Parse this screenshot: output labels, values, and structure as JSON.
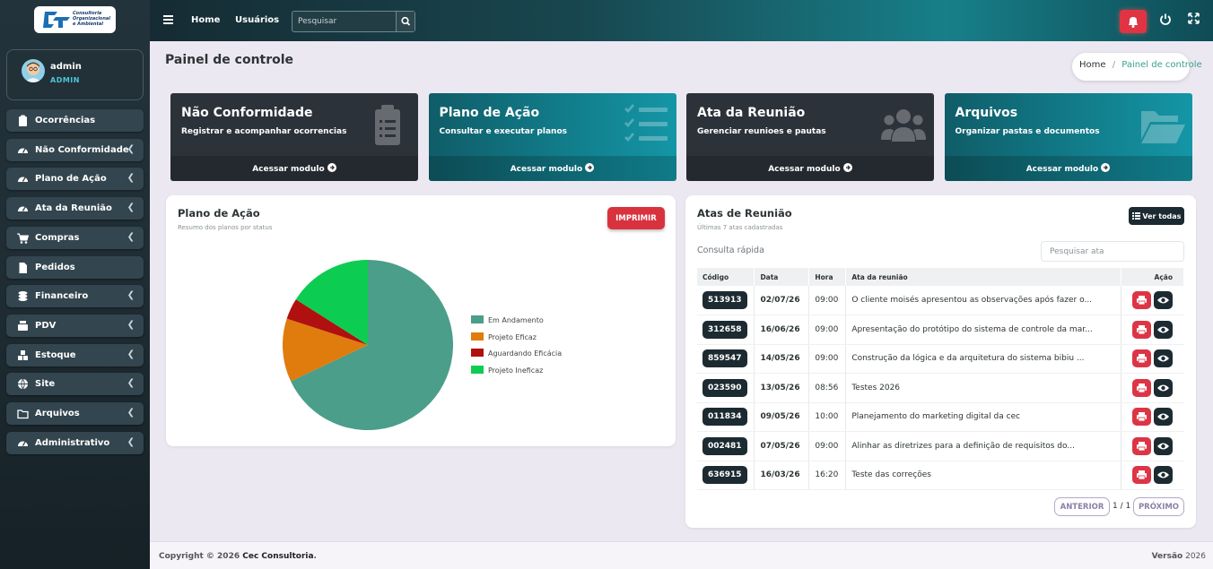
{
  "logo": {
    "text_1": "Consultoria",
    "text_2": "Organizacional",
    "text_3": "e Ambiental"
  },
  "user": {
    "name": "admin",
    "role": "ADMIN"
  },
  "sidebar": {
    "items": [
      {
        "label": "Ocorrências",
        "icon": "clipboard-icon",
        "chevron": false
      },
      {
        "label": "Não Conformidade",
        "icon": "dashboard-icon",
        "chevron": true
      },
      {
        "label": "Plano de Ação",
        "icon": "dashboard-icon",
        "chevron": true
      },
      {
        "label": "Ata da Reunião",
        "icon": "dashboard-icon",
        "chevron": true
      },
      {
        "label": "Compras",
        "icon": "cart-icon",
        "chevron": true
      },
      {
        "label": "Pedidos",
        "icon": "file-icon",
        "chevron": false
      },
      {
        "label": "Financeiro",
        "icon": "coins-icon",
        "chevron": true
      },
      {
        "label": "PDV",
        "icon": "register-icon",
        "chevron": true
      },
      {
        "label": "Estoque",
        "icon": "boxes-icon",
        "chevron": true
      },
      {
        "label": "Site",
        "icon": "globe-icon",
        "chevron": true
      },
      {
        "label": "Arquivos",
        "icon": "folder-icon",
        "chevron": true
      },
      {
        "label": "Administrativo",
        "icon": "dashboard-icon",
        "chevron": true
      }
    ]
  },
  "topbar": {
    "home": "Home",
    "users": "Usuários",
    "search_placeholder": "Pesquisar"
  },
  "page": {
    "title": "Painel de controle",
    "breadcrumb_home": "Home",
    "breadcrumb_sep": "/",
    "breadcrumb_current": "Painel de controle"
  },
  "cards": [
    {
      "title": "Não Conformidade",
      "subtitle": "Registrar e acompanhar ocorrencias",
      "link": "Acessar modulo",
      "icon": "clipboard-list-icon",
      "style": "dark"
    },
    {
      "title": "Plano de Ação",
      "subtitle": "Consultar e executar planos",
      "link": "Acessar modulo",
      "icon": "checklist-icon",
      "style": "teal"
    },
    {
      "title": "Ata da Reunião",
      "subtitle": "Gerenciar reunioes e pautas",
      "link": "Acessar modulo",
      "icon": "users-icon",
      "style": "dark"
    },
    {
      "title": "Arquivos",
      "subtitle": "Organizar pastas e documentos",
      "link": "Acessar modulo",
      "icon": "folder-open-icon",
      "style": "teal"
    }
  ],
  "plano_panel": {
    "title": "Plano de Ação",
    "subtitle": "Resumo dos planos por status",
    "print_label": "IMPRIMIR"
  },
  "chart_data": {
    "type": "pie",
    "title": "",
    "categories": [
      "Em Andamento",
      "Projeto Eficaz",
      "Aguardando Eficácia",
      "Projeto Ineficaz"
    ],
    "values": [
      68,
      12,
      4,
      16
    ],
    "colors": [
      "#4a9e8a",
      "#e07b0e",
      "#b01010",
      "#0ccd52"
    ],
    "legend": "right"
  },
  "atas_panel": {
    "title": "Atas de Reunião",
    "subtitle": "Últimas 7 atas cadastradas",
    "view_all": "Ver todas",
    "quick_label": "Consulta rápida",
    "search_placeholder": "Pesquisar ata",
    "columns": [
      "Código",
      "Data",
      "Hora",
      "Ata da reunião",
      "Ação"
    ],
    "rows": [
      {
        "code": "513913",
        "date": "02/07/26",
        "time": "09:00",
        "title": "O cliente moisés apresentou as observações após fazer o..."
      },
      {
        "code": "312658",
        "date": "16/06/26",
        "time": "09:00",
        "title": "Apresentação do protótipo do sistema de controle da mar..."
      },
      {
        "code": "859547",
        "date": "14/05/26",
        "time": "09:00",
        "title": "Construção da lógica e da arquitetura do sistema bibiu ..."
      },
      {
        "code": "023590",
        "date": "13/05/26",
        "time": "08:56",
        "title": "Testes 2026"
      },
      {
        "code": "011834",
        "date": "09/05/26",
        "time": "10:00",
        "title": "Planejamento do marketing digital da cec"
      },
      {
        "code": "002481",
        "date": "07/05/26",
        "time": "09:00",
        "title": "Alinhar as diretrizes para a definição de requisitos do..."
      },
      {
        "code": "636915",
        "date": "16/03/26",
        "time": "16:20",
        "title": "Teste das correções"
      }
    ],
    "prev": "ANTERIOR",
    "page_info": "1 / 1",
    "next": "PRÓXIMO"
  },
  "footer": {
    "copyright": "Copyright © 2026",
    "company": "Cec Consultoria",
    "dot": ".",
    "version_label": "Versão",
    "version": "2026"
  }
}
